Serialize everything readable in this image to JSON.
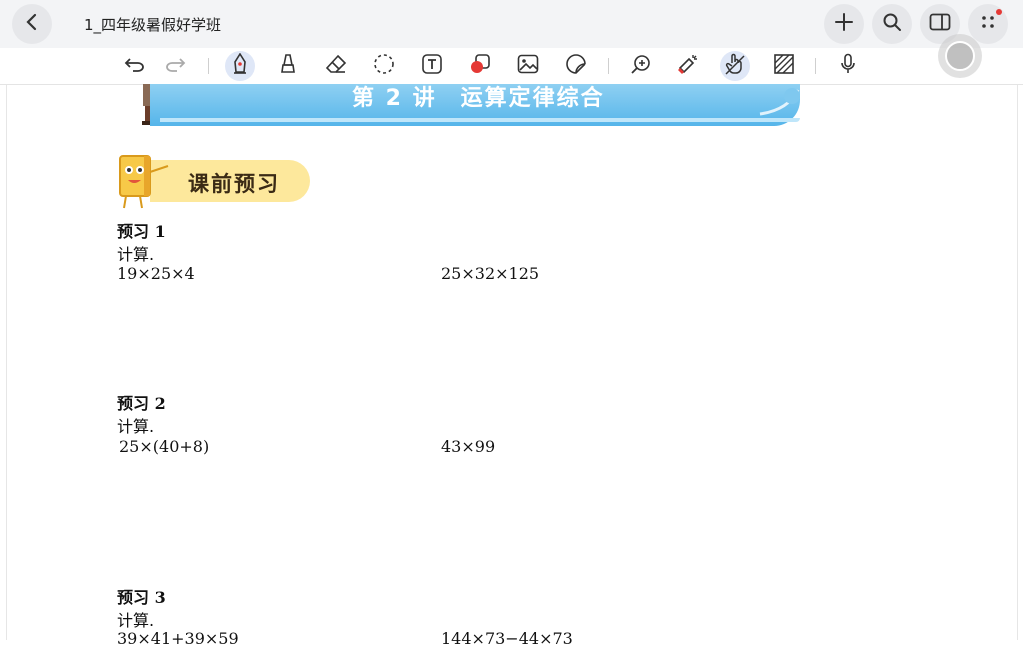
{
  "app": {
    "doc_title": "1_四年级暑假好学班"
  },
  "toolbar": {
    "tools": [
      "undo",
      "redo",
      "pen",
      "highlighter",
      "eraser",
      "lasso",
      "text",
      "shape",
      "image",
      "sticker",
      "zoom",
      "laser",
      "hand",
      "pattern",
      "mic"
    ],
    "active_tool": "pen"
  },
  "page": {
    "banner_title": "第 2 讲　运算定律综合",
    "section_label": "课前预习",
    "exercises": [
      {
        "heading": "预习 1",
        "instruction": "计算.",
        "left": "19×25×4",
        "right": "25×32×125"
      },
      {
        "heading": "预习 2",
        "instruction": "计算.",
        "left": "25×(40+8)",
        "right": "43×99"
      },
      {
        "heading": "预习 3",
        "instruction": "计算.",
        "left": "39×41+39×59",
        "right": "144×73−44×73"
      }
    ]
  },
  "colors": {
    "banner_blue": "#55b5ea",
    "pill_yellow": "#fde89c",
    "active_tool_bg": "#dfe7f7",
    "notification_dot": "#e53935"
  }
}
